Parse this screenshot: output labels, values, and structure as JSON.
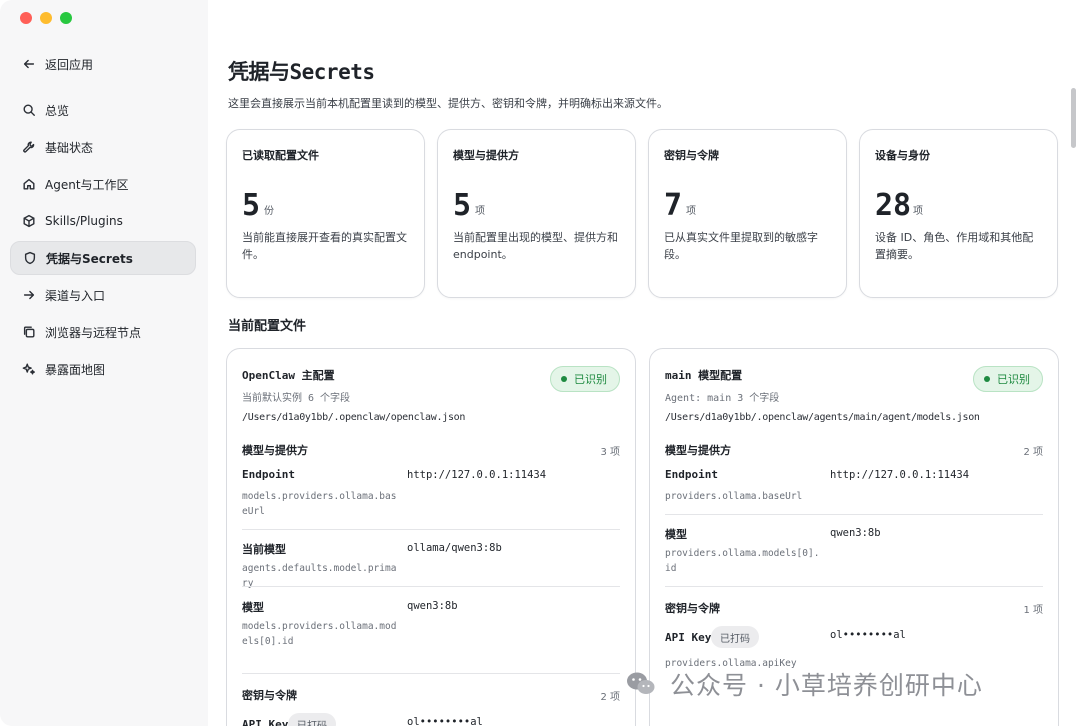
{
  "sidebar": {
    "back_label": "返回应用",
    "items": [
      {
        "label": "总览"
      },
      {
        "label": "基础状态"
      },
      {
        "label": "Agent与工作区"
      },
      {
        "label": "Skills/Plugins"
      },
      {
        "label": "凭据与Secrets"
      },
      {
        "label": "渠道与入口"
      },
      {
        "label": "浏览器与远程节点"
      },
      {
        "label": "暴露面地图"
      }
    ],
    "active_index": 4
  },
  "header": {
    "title": "凭据与Secrets",
    "description": "这里会直接展示当前本机配置里读到的模型、提供方、密钥和令牌，并明确标出来源文件。"
  },
  "stats": [
    {
      "label": "已读取配置文件",
      "value": "5",
      "unit": "份",
      "sub": "当前能直接展开查看的真实配置文件。"
    },
    {
      "label": "模型与提供方",
      "value": "5",
      "unit": "项",
      "sub": "当前配置里出现的模型、提供方和 endpoint。"
    },
    {
      "label": "密钥与令牌",
      "value": "7",
      "unit": "项",
      "sub": "已从真实文件里提取到的敏感字段。"
    },
    {
      "label": "设备与身份",
      "value": "28",
      "unit": "项",
      "sub": "设备 ID、角色、作用域和其他配置摘要。"
    }
  ],
  "section_title": "当前配置文件",
  "files": [
    {
      "name": "OpenClaw 主配置",
      "meta": "当前默认实例  6 个字段",
      "path": "/Users/d1a0y1bb/.openclaw/openclaw.json",
      "badge": "已识别",
      "group1": {
        "title": "模型与提供方",
        "count": "3 项"
      },
      "rows": [
        {
          "key": "Endpoint",
          "path": "models.providers.ollama.baseUrl",
          "value": "http://127.0.0.1:11434"
        },
        {
          "key": "当前模型",
          "path": "agents.defaults.model.primary",
          "value": "ollama/qwen3:8b"
        },
        {
          "key": "模型",
          "path": "models.providers.ollama.models[0].id",
          "value": "qwen3:8b"
        }
      ],
      "group2": {
        "title": "密钥与令牌",
        "count": "2 项"
      },
      "secret": {
        "key": "API Key",
        "tag": "已打码",
        "value": "ol••••••••al"
      }
    },
    {
      "name": "main 模型配置",
      "meta": "Agent: main  3 个字段",
      "path": "/Users/d1a0y1bb/.openclaw/agents/main/agent/models.json",
      "badge": "已识别",
      "group1": {
        "title": "模型与提供方",
        "count": "2 项"
      },
      "rows": [
        {
          "key": "Endpoint",
          "path": "providers.ollama.baseUrl",
          "value": "http://127.0.0.1:11434"
        },
        {
          "key": "模型",
          "path": "providers.ollama.models[0].id",
          "value": "qwen3:8b"
        }
      ],
      "group2": {
        "title": "密钥与令牌",
        "count": "1 项"
      },
      "secret": {
        "key": "API Key",
        "tag": "已打码",
        "value": "ol••••••••al",
        "path": "providers.ollama.apiKey"
      }
    }
  ],
  "watermark": "公众号 · 小草培养创研中心"
}
